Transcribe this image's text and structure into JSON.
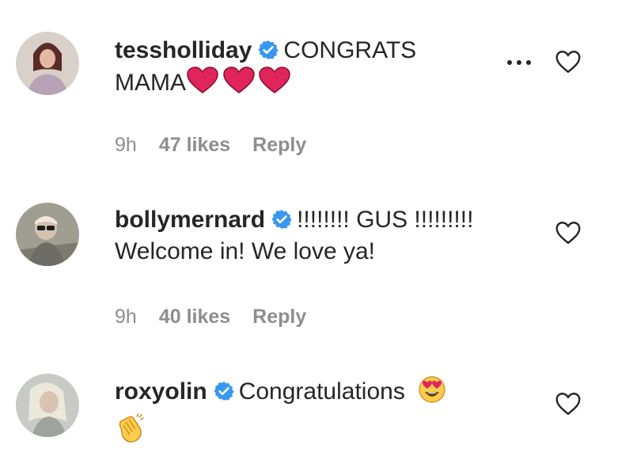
{
  "comments": [
    {
      "username": "tessholliday",
      "text_line1": "CONGRATS",
      "text_line2": "MAMA",
      "time": "9h",
      "likes": "47 likes",
      "reply": "Reply"
    },
    {
      "username": "bollymernard",
      "text_line1": "!!!!!!!! GUS !!!!!!!!!",
      "text_line2": "Welcome in! We love ya!",
      "time": "9h",
      "likes": "40 likes",
      "reply": "Reply"
    },
    {
      "username": "roxyolin",
      "text_line1": "Congratulations"
    }
  ],
  "colors": {
    "verified_badge": "#3897f0",
    "heart_emoji": "#e0245e",
    "meta_text": "#8e8e8e"
  },
  "icons": {
    "more": "more-options-icon",
    "like": "heart-outline-icon",
    "verified": "verified-badge-icon"
  }
}
